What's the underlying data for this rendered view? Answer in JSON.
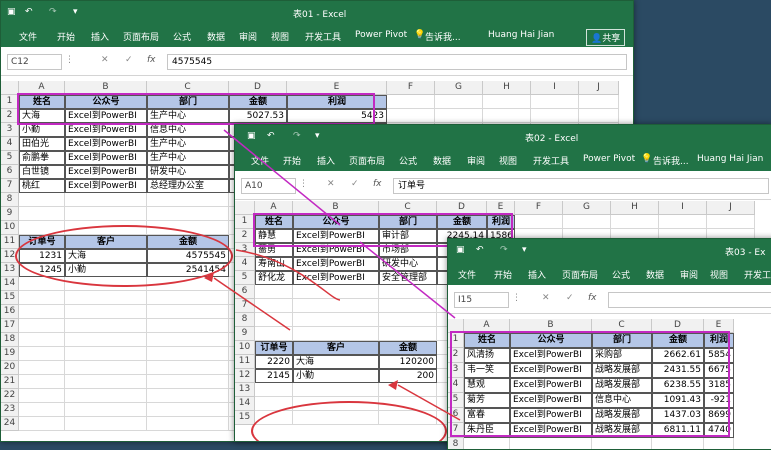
{
  "windows": [
    {
      "key": "w1",
      "title": "表01 - Excel",
      "tabs": [
        "文件",
        "开始",
        "插入",
        "页面布局",
        "公式",
        "数据",
        "审阅",
        "视图",
        "开发工具",
        "Power Pivot"
      ],
      "tell": "告诉我...",
      "user": "Huang Hai Jian",
      "share": "共享",
      "name_box": "C12",
      "formula": "4575545",
      "columns": [
        "A",
        "B",
        "C",
        "D",
        "E",
        "F",
        "G",
        "H",
        "I",
        "J"
      ],
      "rows": [
        "1",
        "2",
        "3",
        "4",
        "5",
        "6",
        "7",
        "8",
        "9",
        "10",
        "11",
        "12",
        "13",
        "14",
        "15",
        "16",
        "17",
        "18",
        "19",
        "20",
        "21",
        "22",
        "23",
        "24"
      ]
    },
    {
      "key": "w2",
      "title": "表02 - Excel",
      "tabs": [
        "文件",
        "开始",
        "插入",
        "页面布局",
        "公式",
        "数据",
        "审阅",
        "视图",
        "开发工具",
        "Power Pivot"
      ],
      "tell": "告诉我...",
      "user": "Huang Hai Jian",
      "name_box": "A10",
      "formula": "订单号",
      "columns": [
        "A",
        "B",
        "C",
        "D",
        "E",
        "F",
        "G",
        "H",
        "I",
        "J"
      ],
      "rows": [
        "1",
        "2",
        "3",
        "4",
        "5",
        "6",
        "7",
        "8",
        "9",
        "10",
        "11",
        "12",
        "13",
        "14",
        "15"
      ]
    },
    {
      "key": "w3",
      "title": "表03 - Ex",
      "tabs": [
        "文件",
        "开始",
        "插入",
        "页面布局",
        "公式",
        "数据",
        "审阅",
        "视图",
        "开发工具"
      ],
      "name_box": "I15",
      "formula": "",
      "columns": [
        "A",
        "B",
        "C",
        "D",
        "E"
      ],
      "rows": [
        "1",
        "2",
        "3",
        "4",
        "5",
        "6",
        "7",
        "8",
        "9"
      ]
    }
  ],
  "sheet1": {
    "headers": [
      "姓名",
      "公众号",
      "部门",
      "金额",
      "利润"
    ],
    "rows": [
      [
        "大海",
        "Excel到PowerBI",
        "生产中心",
        "5027.53",
        "5423"
      ],
      [
        "小勤",
        "Excel到PowerBI",
        "信息中心",
        "",
        ""
      ],
      [
        "田伯光",
        "Excel到PowerBI",
        "生产中心",
        "",
        ""
      ],
      [
        "俞鹏拳",
        "Excel到PowerBI",
        "生产中心",
        "",
        ""
      ],
      [
        "白世镜",
        "Excel到PowerBI",
        "研发中心",
        "",
        ""
      ],
      [
        "桃红",
        "Excel到PowerBI",
        "总经理办公室",
        "",
        ""
      ]
    ],
    "order_headers": [
      "订单号",
      "客户",
      "金额"
    ],
    "orders": [
      [
        "1231",
        "大海",
        "4575545"
      ],
      [
        "1245",
        "小勤",
        "2541454"
      ]
    ]
  },
  "sheet2": {
    "headers": [
      "姓名",
      "公众号",
      "部门",
      "金额",
      "利润"
    ],
    "rows": [
      [
        "静慧",
        "Excel到PowerBI",
        "审计部",
        "2245.14",
        "1586"
      ],
      [
        "薔勇",
        "Excel到PowerBI",
        "市场部",
        "",
        ""
      ],
      [
        "寿南山",
        "Excel到PowerBI",
        "研发中心",
        "9",
        ""
      ],
      [
        "舒化龙",
        "Excel到PowerBI",
        "安全管理部",
        "",
        ""
      ]
    ],
    "order_headers": [
      "订单号",
      "客户",
      "金额"
    ],
    "orders": [
      [
        "2220",
        "大海",
        "120200"
      ],
      [
        "2145",
        "小勤",
        "200"
      ]
    ]
  },
  "sheet3": {
    "headers": [
      "姓名",
      "公众号",
      "部门",
      "金额",
      "利润"
    ],
    "rows": [
      [
        "风清扬",
        "Excel到PowerBI",
        "采购部",
        "2662.61",
        "5854"
      ],
      [
        "韦一笑",
        "Excel到PowerBI",
        "战略发展部",
        "2431.55",
        "6675"
      ],
      [
        "慧观",
        "Excel到PowerBI",
        "战略发展部",
        "6238.55",
        "3185"
      ],
      [
        "菊芳",
        "Excel到PowerBI",
        "信息中心",
        "1091.43",
        "-921"
      ],
      [
        "富春",
        "Excel到PowerBI",
        "战略发展部",
        "1437.03",
        "8699"
      ],
      [
        "朱丹臣",
        "Excel到PowerBI",
        "战略发展部",
        "6811.11",
        "4740"
      ]
    ]
  }
}
